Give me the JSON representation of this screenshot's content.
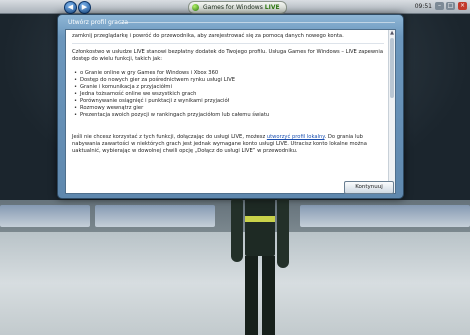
{
  "topbar": {
    "back_glyph": "◀",
    "forward_glyph": "▶",
    "brand_prefix": "Games for Windows",
    "brand_live": "LIVE",
    "time": "09:51",
    "min_glyph": "–",
    "max_glyph": "□",
    "close_glyph": "×"
  },
  "dialog": {
    "title": "Utwórz profil gracza",
    "intro": "zamknij przeglądarkę i powróć do przewodnika, aby zarejestrować się za pomocą danych nowego konta.",
    "p1": "Członkostwo w usłudze LIVE stanowi bezpłatny dodatek do Twojego profilu. Usługa Games for Windows – LIVE zapewnia dostęp do wielu funkcji, takich jak:",
    "features": [
      "o Granie online w gry Games for Windows i Xbox 360",
      "Dostęp do nowych gier za pośrednictwem rynku usługi LIVE",
      "Granie i komunikacja z przyjaciółmi",
      "Jedna tożsamość online we wszystkich grach",
      "Porównywanie osiągnięć i punktacji z wynikami przyjaciół",
      "Rozmowy wewnątrz gier",
      "Prezentacja swoich pozycji w rankingach przyjaciółom lub całemu światu"
    ],
    "p2_before_link": "Jeśli nie chcesz korzystać z tych funkcji, dołączając do usługi LIVE, możesz ",
    "p2_link": "utworzyć profil lokalny",
    "p2_after_link": ". Do grania lub nabywania zawartości w niektórych grach jest jednak wymagane konto usługi LIVE. Utracisz konto lokalne można uaktualnić, wybierając w dowolnej chwili opcję „Dołącz do usługi LIVE” w przewodniku.",
    "continue_label": "Kontynuuj"
  },
  "colors": {
    "dialog_frame": "#6c97bd",
    "link": "#1a4fb0"
  }
}
